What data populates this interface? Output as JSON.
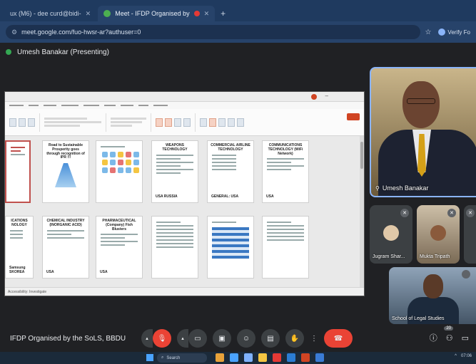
{
  "browser": {
    "tabs": [
      {
        "label": "ux (M6) - dee curd@bidi-",
        "active": false
      },
      {
        "label": "Meet - IFDP Organised by",
        "active": true
      }
    ],
    "new_tab": "+",
    "url": "meet.google.com/fuo-hwsr-ar?authuser=0",
    "profile_label": "Verify Fo"
  },
  "meet": {
    "presenting_label": "Umesh Banakar (Presenting)",
    "meeting_title": "IFDP Organised by the SoLS, BBDU",
    "participant_count": "20",
    "speaker_name": "Umesh Banakar",
    "participants": [
      {
        "name": "Jugram Shar..."
      },
      {
        "name": "Mukta Tripath"
      },
      {
        "name": "School of Legal Studies"
      }
    ]
  },
  "slides": {
    "status_left": "Accessibility: Investigate",
    "rows": [
      [
        {
          "num": "",
          "title": "",
          "foot": ""
        },
        {
          "num": "",
          "title": "Road to Sustainable Prosperity goes through recognition of IPR !!!",
          "foot": ""
        },
        {
          "num": "",
          "title": "",
          "foot": ""
        },
        {
          "num": "",
          "title": "WEAPONS TECHNOLOGY",
          "foot": "USA  RUSSIA"
        },
        {
          "num": "",
          "title": "COMMERCIAL AIRLINE TECHNOLOGY",
          "foot": "GENERAL: USA"
        },
        {
          "num": "",
          "title": "COMMUNICATIONS TECHNOLOGY (WiFi Network)",
          "foot": "USA"
        }
      ],
      [
        {
          "num": "",
          "title": "ICATIONS NOLOGY",
          "foot": "Samsung SKOREA"
        },
        {
          "num": "",
          "title": "CHEMICAL INDUSTRY (INORGANIC ACID)",
          "foot": "USA"
        },
        {
          "num": "",
          "title": "PHARMACEUTICAL (Company) Fish Blusters",
          "foot": "USA"
        },
        {
          "num": "",
          "title": "",
          "foot": ""
        },
        {
          "num": "",
          "title": "",
          "foot": ""
        },
        {
          "num": "",
          "title": "",
          "foot": ""
        }
      ]
    ]
  },
  "taskbar": {
    "search_label": "Search",
    "tray_time": "07:06"
  },
  "colors": {
    "tab_bar": "#1f3a5f",
    "meet_bg": "#202124",
    "end_call": "#ea4335",
    "speaker_border": "#8ab4f8"
  }
}
